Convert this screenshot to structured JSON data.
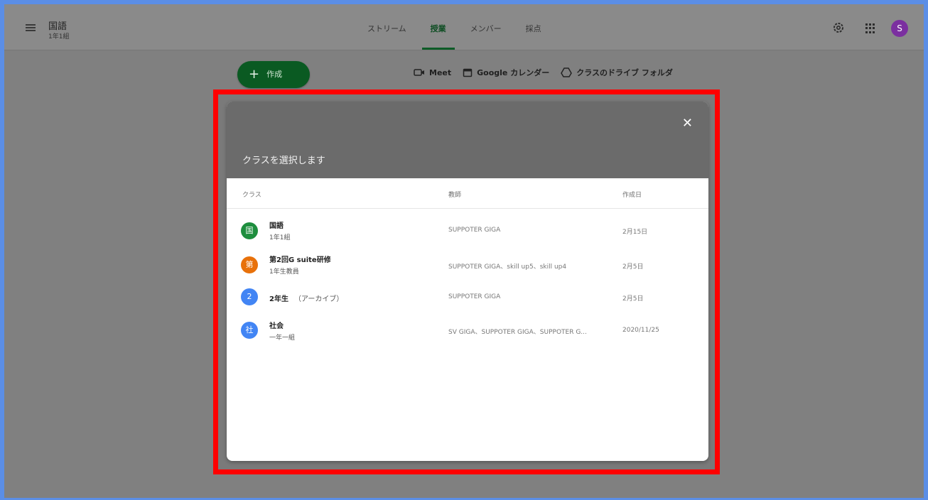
{
  "app": {
    "class_title": "国語",
    "class_section": "1年1組",
    "tabs": [
      {
        "label": "ストリーム",
        "active": false
      },
      {
        "label": "授業",
        "active": true
      },
      {
        "label": "メンバー",
        "active": false
      },
      {
        "label": "採点",
        "active": false
      }
    ],
    "avatar_initial": "S",
    "avatar_color": "#7b2fa0",
    "accent_color": "#0d5b27"
  },
  "toolbar": {
    "create_label": "作成",
    "meet_label": "Meet",
    "calendar_label": "Google カレンダー",
    "drive_label": "クラスのドライブ フォルダ"
  },
  "dialog": {
    "title": "クラスを選択します",
    "columns": {
      "class": "クラス",
      "teacher": "教師",
      "created": "作成日"
    },
    "rows": [
      {
        "initial": "国",
        "color": "#1e8e3e",
        "name": "国語",
        "archived": "",
        "section": "1年1組",
        "teacher": "SUPPOTER GIGA",
        "created": "2月15日"
      },
      {
        "initial": "第",
        "color": "#e8710a",
        "name": "第2回G suite研修",
        "archived": "",
        "section": "1年生教員",
        "teacher": "SUPPOTER GIGA、skill up5、skill up4",
        "created": "2月5日"
      },
      {
        "initial": "2",
        "color": "#4285f4",
        "name": "2年生",
        "archived": "（アーカイブ）",
        "section": "",
        "teacher": "SUPPOTER GIGA",
        "created": "2月5日"
      },
      {
        "initial": "社",
        "color": "#4285f4",
        "name": "社会",
        "archived": "",
        "section": "一年一組",
        "teacher": "SV GIGA、SUPPOTER GIGA、SUPPOTER G...",
        "created": "2020/11/25"
      }
    ]
  }
}
